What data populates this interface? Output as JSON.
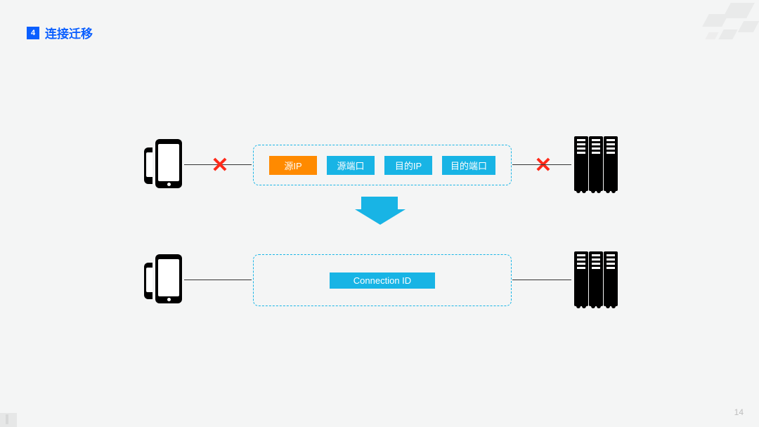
{
  "header": {
    "badge": "4",
    "title": "连接迁移"
  },
  "row1": {
    "chips": {
      "src_ip": "源IP",
      "src_port": "源端口",
      "dst_ip": "目的IP",
      "dst_port": "目的端口"
    },
    "cross_glyph": "✕"
  },
  "row2": {
    "chip": "Connection ID"
  },
  "page_number": "14"
}
